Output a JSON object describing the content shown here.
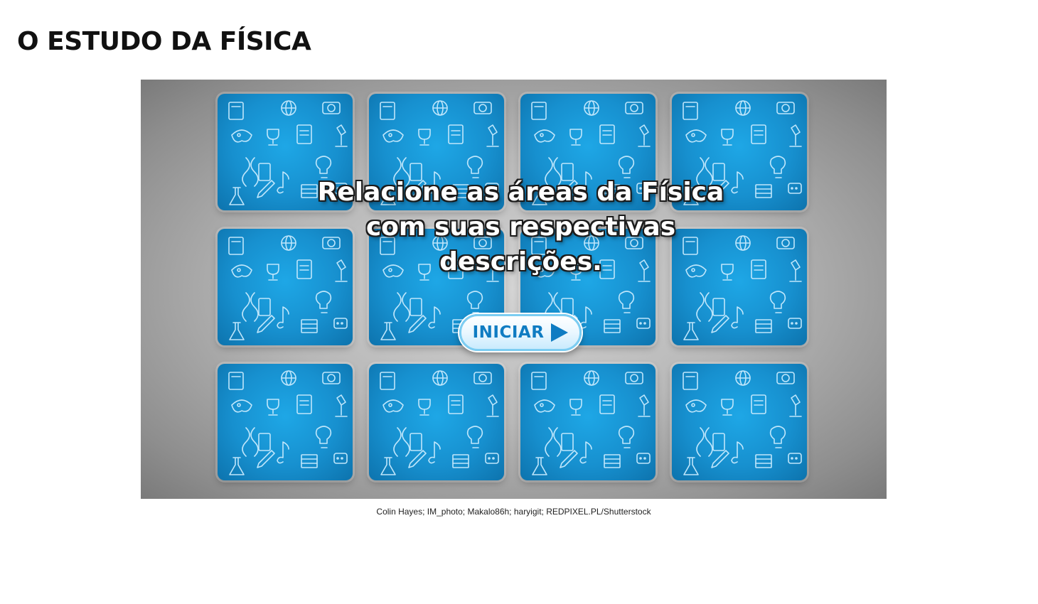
{
  "page": {
    "title": "O ESTUDO DA FÍSICA"
  },
  "game": {
    "instruction": "Relacione as áreas da Física\ncom suas respectivas\ndescrições.",
    "start_button_label": "INICIAR",
    "start_button_icon": "play-arrow-icon",
    "card_pattern_icons": [
      "book-icon",
      "globe-icon",
      "camera-icon",
      "palette-icon",
      "clipboard-icon",
      "trophy-icon",
      "microscope-icon",
      "dna-icon",
      "lightbulb-icon",
      "flask-icon",
      "music-note-icon",
      "tablet-icon",
      "abacus-icon",
      "chat-icon",
      "pencil-icon"
    ],
    "colors": {
      "card_blue": "#1790cf",
      "button_text_blue": "#0f7cc2"
    }
  },
  "credit": {
    "text": "Colin Hayes; IM_photo; Makalo86h; haryigit; REDPIXEL.PL/Shutterstock"
  }
}
